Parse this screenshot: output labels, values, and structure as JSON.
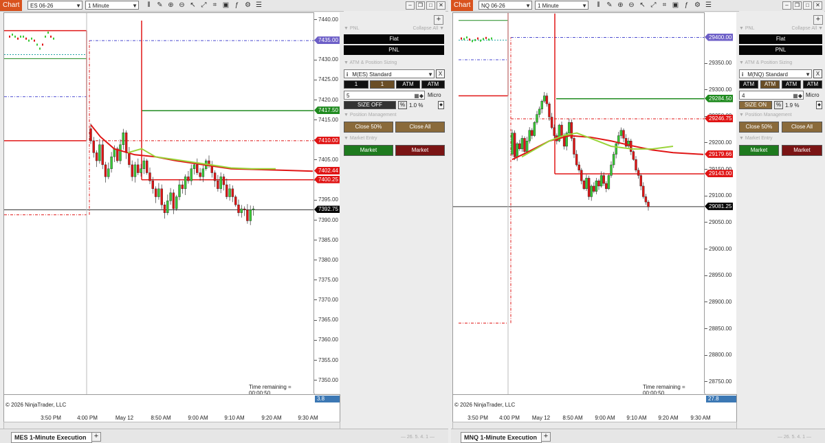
{
  "colors": {
    "up": "#39c936",
    "down": "#e01515",
    "brand": "#d9531e",
    "black": "#050505",
    "market_buy": "#1e7a1e",
    "market_sell": "#7a1414",
    "size_btn": "#8a6a3a"
  },
  "left": {
    "badge": "Chart",
    "instrument": "ES 06-26",
    "interval": "1 Minute",
    "price_ticks": [
      "7440.00",
      "7435.00",
      "7430.00",
      "7425.00",
      "7420.00",
      "7415.00",
      "7410.00",
      "7405.00",
      "7400.00",
      "7395.00",
      "7390.00",
      "7385.00",
      "7380.00",
      "7375.00",
      "7370.00",
      "7365.00",
      "7360.00",
      "7355.00",
      "7350.00"
    ],
    "flags": [
      {
        "label": "7435.00",
        "color": "#6c5ec7",
        "price": 7435.0
      },
      {
        "label": "7417.50",
        "color": "#1e8a1e",
        "price": 7417.5
      },
      {
        "label": "7410.00",
        "color": "#e01515",
        "price": 7410.0
      },
      {
        "label": "7402.44",
        "color": "#e01515",
        "price": 7402.44
      },
      {
        "label": "7400.25",
        "color": "#e01515",
        "price": 7400.25
      },
      {
        "label": "7392.75",
        "color": "#050505",
        "price": 7392.75
      }
    ],
    "time_ticks": [
      "3:50 PM",
      "4:00 PM",
      "May 12",
      "8:50 AM",
      "9:00 AM",
      "9:10 AM",
      "9:20 AM",
      "9:30 AM"
    ],
    "copyright": "© 2026 NinjaTrader, LLC",
    "time_remaining": "Time remaining = 00:00:50",
    "bottom_value": "3.8",
    "tab": "MES 1-Minute Execution",
    "version": "— 26. 5. 4. 1 —",
    "panel": {
      "pnl_header": "▼ PNL",
      "collapse": "Collapse All ▼",
      "flat": "Flat",
      "pnl": "PNL",
      "atm_header": "▼ ATM & Position Sizing",
      "template": "M(ES) Standard",
      "close_x": "X",
      "qty_a": "1",
      "qty_b": "1",
      "atm_a": "ATM",
      "atm_b": "ATM",
      "size_value": "5",
      "micro": "Micro",
      "size_toggle": "SIZE OFF",
      "pct_btn": "%",
      "pct_value": "1.0 %",
      "pos_header": "▼ Position Management",
      "close50": "Close 50%",
      "closeall": "Close All",
      "entry_header": "▼ Market Entry",
      "buy": "Market",
      "sell": "Market",
      "plus": "+"
    }
  },
  "right": {
    "badge": "Chart",
    "instrument": "NQ 06-26",
    "interval": "1 Minute",
    "price_ticks": [
      "29350.00",
      "29300.00",
      "29250.00",
      "29200.00",
      "29150.00",
      "29100.00",
      "29050.00",
      "29000.00",
      "28950.00",
      "28900.00",
      "28850.00",
      "28800.00",
      "28750.00"
    ],
    "flags": [
      {
        "label": "29400.00",
        "color": "#6c5ec7",
        "price": 29400.0
      },
      {
        "label": "29284.50",
        "color": "#1e8a1e",
        "price": 29284.5
      },
      {
        "label": "29246.75",
        "color": "#e01515",
        "price": 29246.75
      },
      {
        "label": "29179.66",
        "color": "#e01515",
        "price": 29179.66
      },
      {
        "label": "29143.00",
        "color": "#e01515",
        "price": 29143.0
      },
      {
        "label": "29081.25",
        "color": "#050505",
        "price": 29081.25
      }
    ],
    "time_ticks": [
      "3:50 PM",
      "4:00 PM",
      "May 12",
      "8:50 AM",
      "9:00 AM",
      "9:10 AM",
      "9:20 AM",
      "9:30 AM"
    ],
    "copyright": "© 2026 NinjaTrader, LLC",
    "time_remaining": "Time remaining = 00:00:50",
    "bottom_value": "27.8",
    "tab": "MNQ 1-Minute Execution",
    "version": "— 26. 5. 4. 1 —",
    "panel": {
      "pnl_header": "▼ PNL",
      "collapse": "Collapse All ▼",
      "flat": "Flat",
      "pnl": "PNL",
      "atm_header": "▼ ATM & Position Sizing",
      "template": "M(NQ) Standard",
      "close_x": "X",
      "qty_a": "ATM",
      "qty_b": "ATM",
      "atm_a": "ATM",
      "atm_b": "ATM",
      "size_value": "4",
      "micro": "Micro",
      "size_toggle": "SIZE ON",
      "pct_btn": "%",
      "pct_value": "1.9 %",
      "pos_header": "▼ Position Management",
      "close50": "Close 50%",
      "closeall": "Close All",
      "entry_header": "▼ Market Entry",
      "buy": "Market",
      "sell": "Market",
      "plus": "+"
    }
  },
  "toolbar_icons": [
    "bar-chart-icon",
    "pencil-icon",
    "zoom-in-icon",
    "zoom-out-icon",
    "pointer-icon",
    "draw-icon",
    "properties-icon",
    "data-box-icon",
    "indicators-icon",
    "strategies-icon",
    "list-icon"
  ]
}
